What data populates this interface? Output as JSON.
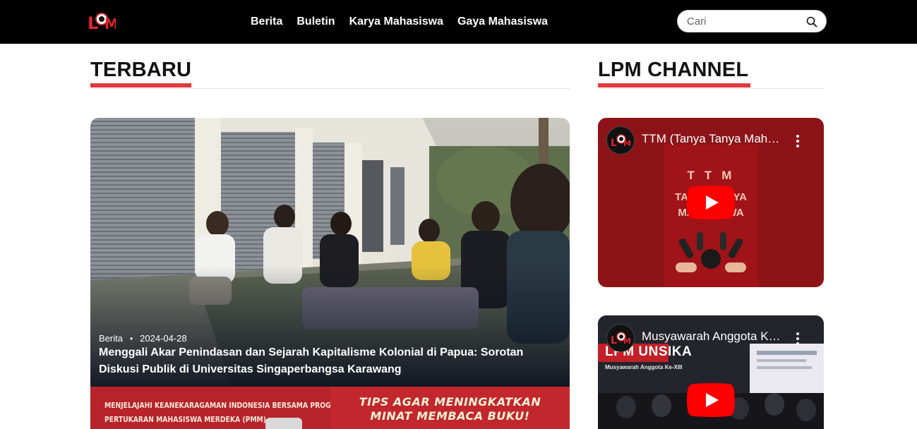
{
  "navbar": {
    "logo_text": "LPM",
    "links": [
      "Berita",
      "Buletin",
      "Karya Mahasiswa",
      "Gaya Mahasiswa"
    ],
    "search": {
      "placeholder": "Cari",
      "value": "",
      "icon": "search-icon"
    }
  },
  "sections": {
    "latest_title": "TERBARU",
    "channel_title": "LPM CHANNEL",
    "accent_color": "#e03a3e"
  },
  "featured": {
    "category": "Berita",
    "date": "2024-04-28",
    "title": "Menggali Akar Penindasan dan Sejarah Kapitalisme Kolonial di Papua: Sorotan Diskusi Publik di Universitas Singaperbangsa Karawang"
  },
  "thumbnails": [
    {
      "line1": "MENJELAJAHI KEANEKARAGAMAN INDONESIA BERSAMA PROGRAM",
      "line2": "PERTUKARAN MAHASISWA MERDEKA (PMM)"
    },
    {
      "line1": "TIPS AGAR MENINGKATKAN",
      "line2": "MINAT MEMBACA BUKU!"
    }
  ],
  "videos": [
    {
      "title": "TTM (Tanya Tanya Mahasiswa)",
      "poster_title": "TTM",
      "poster_line1": "TANYA TANYA",
      "poster_line2": "MAHASISWA"
    },
    {
      "title": "Musyawarah Anggota Ke-XIII",
      "poster_banner": "LPM UNSIKA",
      "poster_sub": "Musyawarah Anggota Ke-XIII"
    }
  ]
}
